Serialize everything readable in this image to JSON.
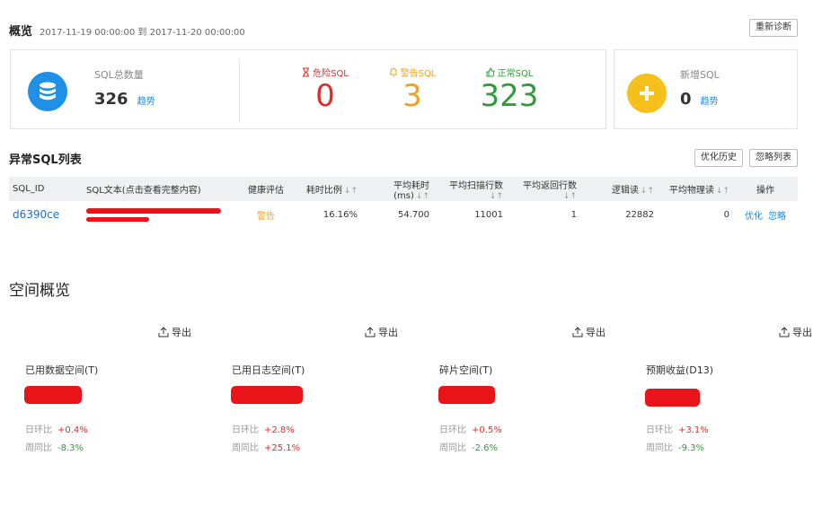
{
  "overview": {
    "title": "概览",
    "date_range": "2017-11-19 00:00:00 到 2017-11-20 00:00:00",
    "rediagnose_label": "重新诊断"
  },
  "sql_total": {
    "label": "SQL总数量",
    "value": "326",
    "trend_label": "趋势"
  },
  "stats": [
    {
      "label": "危险SQL",
      "value": "0",
      "color": "#e02b2b",
      "icon": "hourglass-icon"
    },
    {
      "label": "警告SQL",
      "value": "3",
      "color": "#f0a020",
      "icon": "bell-icon"
    },
    {
      "label": "正常SQL",
      "value": "323",
      "color": "#2e9d3a",
      "icon": "thumbs-up-icon"
    }
  ],
  "new_sql": {
    "label": "新增SQL",
    "value": "0",
    "trend_label": "趋势"
  },
  "abnormal": {
    "title": "异常SQL列表",
    "history_label": "优化历史",
    "ignore_list_label": "忽略列表",
    "columns": [
      "SQL_ID",
      "SQL文本(点击查看完整内容)",
      "健康评估",
      "耗时比例",
      "平均耗时(ms)",
      "平均扫描行数",
      "平均返回行数",
      "逻辑读",
      "平均物理读",
      "操作"
    ],
    "rows": [
      {
        "sql_id": "d6390ce",
        "health": "警告",
        "time_ratio": "16.16%",
        "avg_time": "54.700",
        "avg_scan": "11001",
        "avg_return": "1",
        "logical_read": "22882",
        "avg_phys_read": "0",
        "op_optimize": "优化",
        "op_ignore": "忽略"
      }
    ]
  },
  "space": {
    "title": "空间概览",
    "export_label": "导出",
    "ratio_day_label": "日环比",
    "ratio_week_label": "周同比",
    "cards": [
      {
        "title": "已用数据空间(T)",
        "day": "+0.4%",
        "week": "-8.3%"
      },
      {
        "title": "已用日志空间(T)",
        "day": "+2.8%",
        "week": "+25.1%"
      },
      {
        "title": "碎片空间(T)",
        "day": "+0.5%",
        "week": "-2.6%"
      },
      {
        "title": "预期收益(D13)",
        "day": "+3.1%",
        "week": "-9.3%"
      }
    ]
  },
  "colors": {
    "accent": "#1e88e5",
    "danger": "#e02b2b",
    "warning": "#f0a020",
    "success": "#2e9d3a",
    "redaction": "#e8141a"
  }
}
